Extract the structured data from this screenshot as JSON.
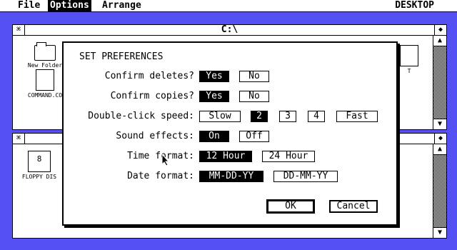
{
  "menubar": {
    "items": [
      "File",
      "Options",
      "Arrange"
    ],
    "active": "Options",
    "right_title": "DESKTOP"
  },
  "window_top": {
    "title": "C:\\",
    "close_glyph": "⌘",
    "full_glyph": "◆",
    "icons": [
      "New Folder",
      "COMMAND.CO",
      "T"
    ]
  },
  "window_bottom": {
    "close_glyph": "⌘",
    "full_glyph": "◆",
    "icons": [
      "FLOPPY DIS"
    ]
  },
  "dialog": {
    "title": "SET PREFERENCES",
    "rows": {
      "confirm_deletes": {
        "label": "Confirm deletes?",
        "options": [
          "Yes",
          "No"
        ],
        "selected": "Yes"
      },
      "confirm_copies": {
        "label": "Confirm copies?",
        "options": [
          "Yes",
          "No"
        ],
        "selected": "Yes"
      },
      "double_click": {
        "label": "Double-click speed:",
        "options": [
          "Slow",
          "2",
          "3",
          "4",
          "Fast"
        ],
        "selected": "2"
      },
      "sound": {
        "label": "Sound effects:",
        "options": [
          "On",
          "Off"
        ],
        "selected": "On"
      },
      "time_format": {
        "label": "Time format:",
        "options": [
          "12 Hour",
          "24 Hour"
        ],
        "selected": "12 Hour"
      },
      "date_format": {
        "label": "Date format:",
        "options": [
          "MM-DD-YY",
          "DD-MM-YY"
        ],
        "selected": "MM-DD-YY"
      }
    },
    "ok_label": "OK",
    "cancel_label": "Cancel"
  },
  "colors": {
    "desktop": "#5450f4",
    "window": "#ffffff",
    "ink": "#000000"
  }
}
